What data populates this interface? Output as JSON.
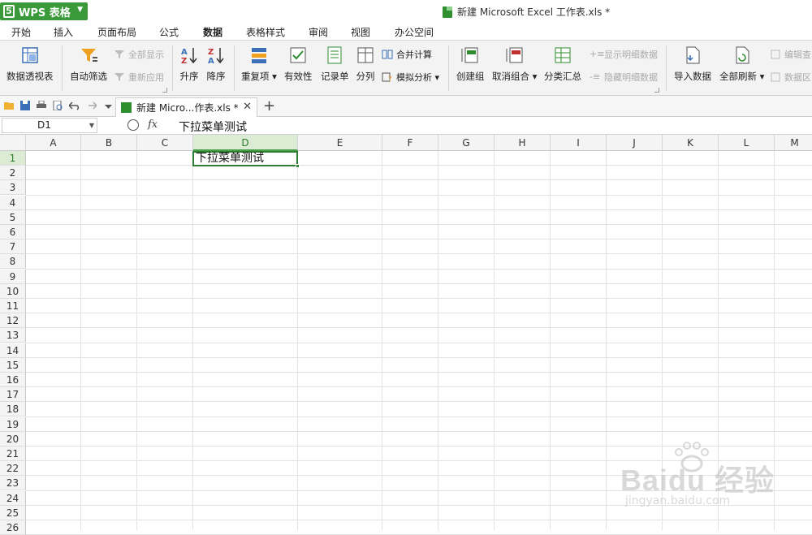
{
  "app": {
    "brand": "WPS 表格",
    "brand_color": "#3a9a3a",
    "doc_title": "新建 Microsoft Excel 工作表.xls *"
  },
  "menu": [
    {
      "label": "开始"
    },
    {
      "label": "插入"
    },
    {
      "label": "页面布局"
    },
    {
      "label": "公式"
    },
    {
      "label": "数据",
      "active": true
    },
    {
      "label": "表格样式"
    },
    {
      "label": "审阅"
    },
    {
      "label": "视图"
    },
    {
      "label": "办公空间"
    }
  ],
  "ribbon": {
    "pivot": "数据透视表",
    "autofilter": "自动筛选",
    "show_all": "全部显示",
    "reapply": "重新应用",
    "sort_asc": "升序",
    "sort_desc": "降序",
    "duplicates": "重复项",
    "validity": "有效性",
    "record_form": "记录单",
    "split": "分列",
    "consolidate": "合并计算",
    "what_if": "模拟分析",
    "group": "创建组",
    "ungroup": "取消组合",
    "subtotal": "分类汇总",
    "show_detail": "显示明细数据",
    "hide_detail": "隐藏明细数据",
    "import": "导入数据",
    "refresh_all": "全部刷新",
    "edit_query": "编辑查",
    "data_area": "数据区"
  },
  "tabbar": {
    "doc_tab": "新建 Micro...作表.xls *",
    "close": "✕",
    "add": "+"
  },
  "formula": {
    "name_box": "D1",
    "fx": "fx",
    "value": "下拉菜单测试"
  },
  "sheet": {
    "columns": [
      "A",
      "B",
      "C",
      "D",
      "E",
      "F",
      "G",
      "H",
      "I",
      "J",
      "K",
      "L",
      "M"
    ],
    "rows": [
      "1",
      "2",
      "3",
      "4",
      "5",
      "6",
      "7",
      "8",
      "9",
      "10",
      "11",
      "12",
      "13",
      "14",
      "15",
      "16",
      "17",
      "18",
      "19",
      "20",
      "21",
      "22",
      "23",
      "24",
      "25",
      "26"
    ],
    "selected_column": "D",
    "selected_row": "1",
    "active_cell_value": "下拉菜单测试"
  },
  "watermark": {
    "logo": "Bai du 经验",
    "url": "jingyan.baidu.com"
  }
}
